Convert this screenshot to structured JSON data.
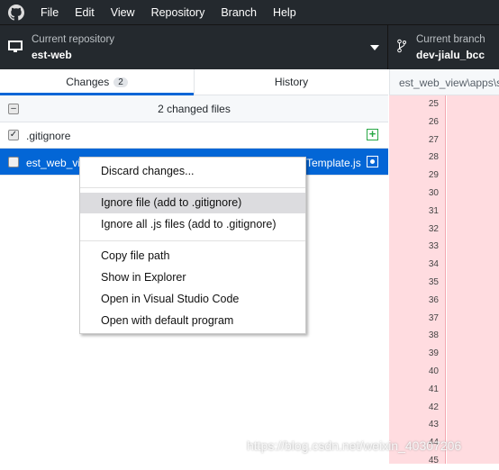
{
  "menubar": {
    "items": [
      "File",
      "Edit",
      "View",
      "Repository",
      "Branch",
      "Help"
    ]
  },
  "toolbar": {
    "repo_label": "Current repository",
    "repo_value": "est-web",
    "branch_label": "Current branch",
    "branch_value": "dev-jialu_bcc"
  },
  "tabs": {
    "changes": "Changes",
    "changes_count": "2",
    "history": "History"
  },
  "path": "est_web_view\\apps\\s",
  "changes": {
    "header": "2 changed files",
    "files": [
      {
        "name": ".gitignore",
        "checked": true,
        "status": "added"
      },
      {
        "name_start": "est_web_vi",
        "name_end": "Template.js",
        "checked": false,
        "status": "modified"
      }
    ]
  },
  "diff": {
    "line_numbers": [
      "25",
      "26",
      "27",
      "28",
      "29",
      "30",
      "31",
      "32",
      "33",
      "34",
      "35",
      "36",
      "37",
      "38",
      "39",
      "40",
      "41",
      "42",
      "43",
      "44",
      "45"
    ]
  },
  "context_menu": {
    "items": [
      "Discard changes...",
      "Ignore file (add to .gitignore)",
      "Ignore all .js files (add to .gitignore)",
      "Copy file path",
      "Show in Explorer",
      "Open in Visual Studio Code",
      "Open with default program"
    ]
  },
  "watermark": "https://blog.csdn.net/weixin_40307206",
  "colors": {
    "accent": "#0366d6",
    "dark": "#24292e",
    "deleted_bg": "#ffdce0",
    "added": "#28a745"
  }
}
